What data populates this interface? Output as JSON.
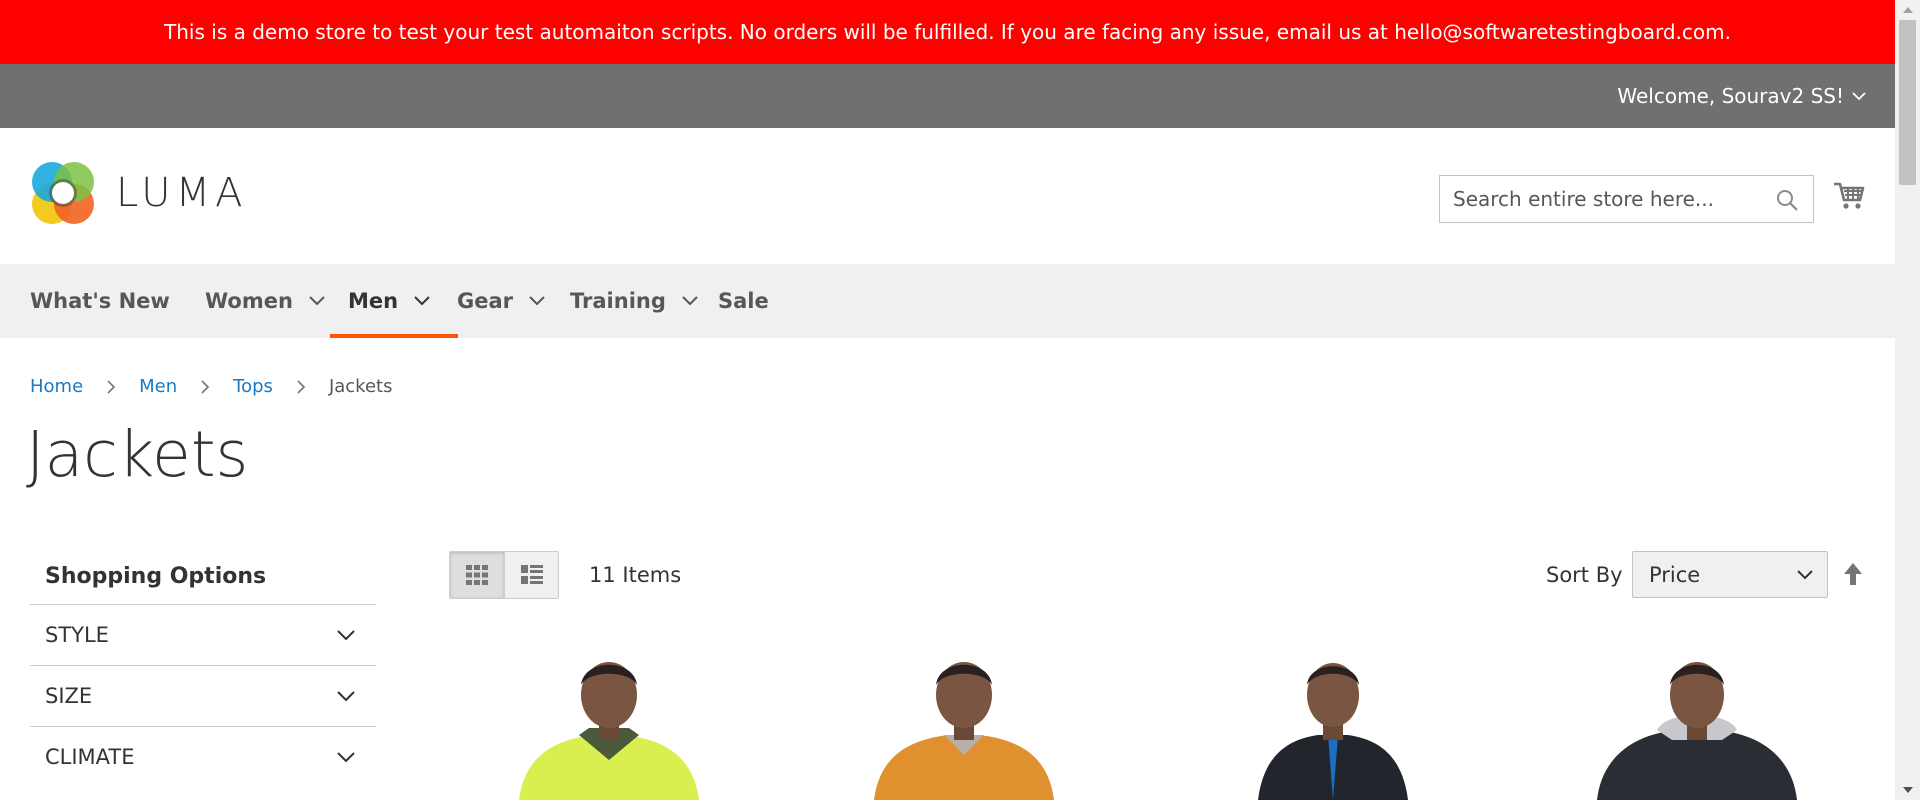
{
  "banner": {
    "text": "This is a demo store to test your test automaiton scripts. No orders will be fulfilled. If you are facing any issue, email us at hello@softwaretestingboard.com."
  },
  "topbar": {
    "welcome": "Welcome, Sourav2 SS!"
  },
  "header": {
    "logo_text": "LUMA",
    "search_placeholder": "Search entire store here..."
  },
  "nav": {
    "items": [
      {
        "label": "What's New",
        "dropdown": false
      },
      {
        "label": "Women",
        "dropdown": true
      },
      {
        "label": "Men",
        "dropdown": true,
        "active": true
      },
      {
        "label": "Gear",
        "dropdown": true
      },
      {
        "label": "Training",
        "dropdown": true
      },
      {
        "label": "Sale",
        "dropdown": false
      }
    ]
  },
  "breadcrumbs": [
    "Home",
    "Men",
    "Tops",
    "Jackets"
  ],
  "page": {
    "title": "Jackets"
  },
  "sidebar": {
    "title": "Shopping Options",
    "filters": [
      "STYLE",
      "SIZE",
      "CLIMATE"
    ]
  },
  "toolbar": {
    "count": "11 Items",
    "sort_label": "Sort By",
    "sort_value": "Price"
  },
  "colors": {
    "banner": "#ff0000",
    "topbar": "#6e716e",
    "nav_bg": "#f0f0f0",
    "accent": "#ff5501",
    "link": "#1979c3"
  },
  "icons": [
    "chevron-down-icon",
    "search-icon",
    "cart-icon",
    "grid-icon",
    "list-icon",
    "sort-arrow-icon"
  ],
  "products": [
    {
      "jacket_color": "#d8ef4f"
    },
    {
      "jacket_color": "#e0902e"
    },
    {
      "jacket_color": "#22262c"
    },
    {
      "jacket_color": "#2b2d34"
    }
  ]
}
